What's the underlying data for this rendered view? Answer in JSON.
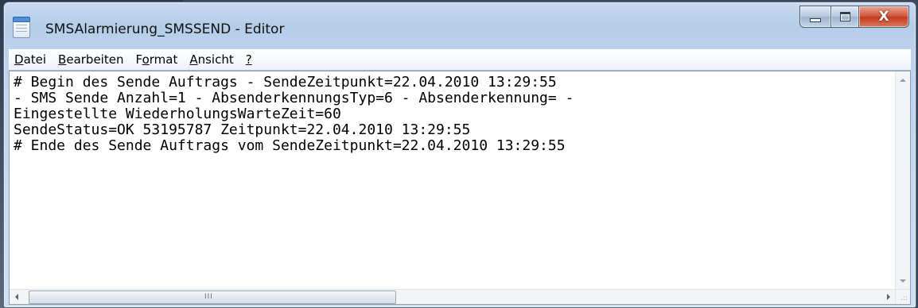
{
  "window": {
    "title": "SMSAlarmierung_SMSSEND - Editor"
  },
  "menu": [
    {
      "label": "Datei",
      "accel": "D",
      "rest": "atei"
    },
    {
      "label": "Bearbeiten",
      "accel": "B",
      "rest": "earbeiten"
    },
    {
      "label": "Format",
      "pre": "F",
      "accel": "o",
      "rest": "rmat"
    },
    {
      "label": "Ansicht",
      "accel": "A",
      "rest": "nsicht"
    },
    {
      "label": "?",
      "accel": "?",
      "rest": ""
    }
  ],
  "content": {
    "lines": [
      "# Begin des Sende Auftrags - SendeZeitpunkt=22.04.2010 13:29:55",
      "- SMS Sende Anzahl=1 - AbsenderkennungsTyp=6 - Absenderkennung= -",
      "Eingestellte WiederholungsWarteZeit=60",
      "SendeStatus=OK 53195787 Zeitpunkt=22.04.2010 13:29:55",
      "# Ende des Sende Auftrags vom SendeZeitpunkt=22.04.2010 13:29:55"
    ]
  },
  "icons": {
    "app": "notepad-icon",
    "minimize": "minimize-icon",
    "maximize": "maximize-icon",
    "close": "close-icon"
  },
  "colors": {
    "close_button": "#c84a2c",
    "title_bar": "#b9d1ea"
  }
}
